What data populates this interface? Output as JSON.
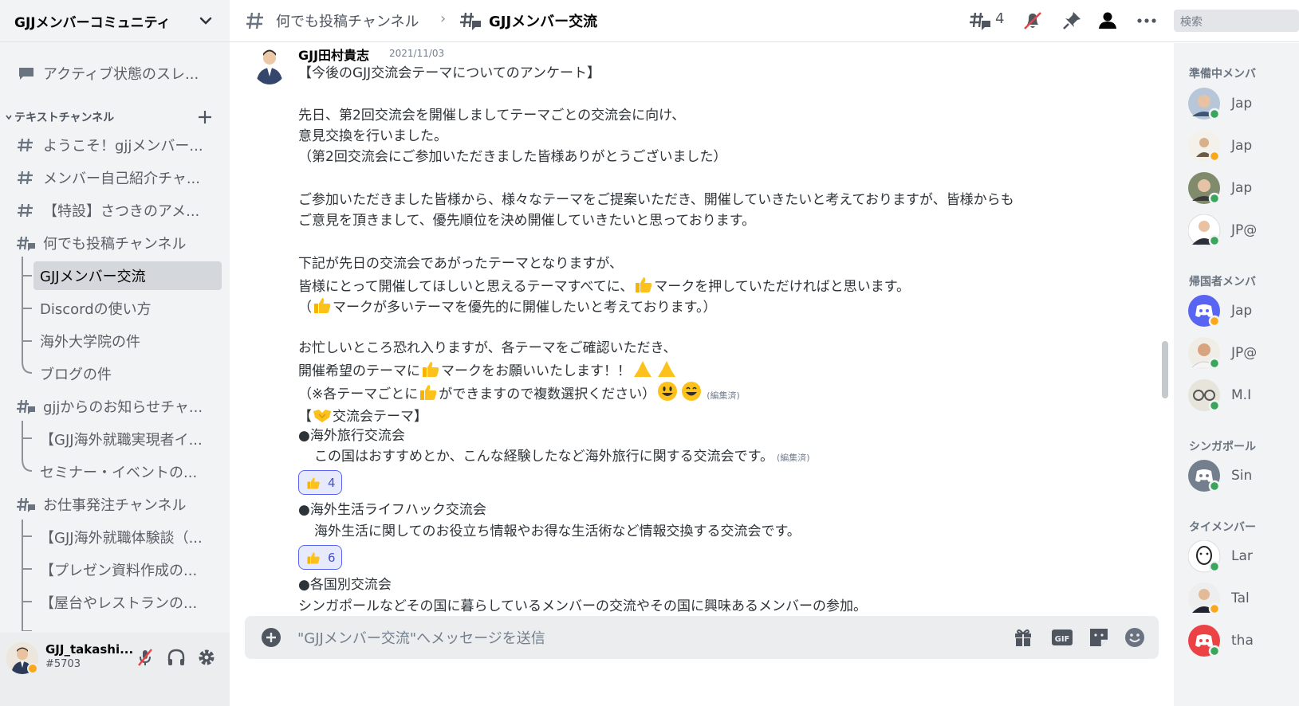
{
  "server": {
    "name": "GJJメンバーコミュニティ"
  },
  "sidebar": {
    "active_threads": "アクティブ状態のスレ...",
    "category": "テキストチャンネル",
    "items": [
      {
        "label": "ようこそ！gjjメンバー..."
      },
      {
        "label": "メンバー自己紹介チャ..."
      },
      {
        "label": "【特設】さつきのアメ..."
      },
      {
        "label": "何でも投稿チャンネル"
      },
      {
        "label": "GJJメンバー交流"
      },
      {
        "label": "Discordの使い方"
      },
      {
        "label": "海外大学院の件"
      },
      {
        "label": "ブログの件"
      },
      {
        "label": "gjjからのお知らせチャ..."
      },
      {
        "label": "【GJJ海外就職実現者イ..."
      },
      {
        "label": "セミナー・イベントの..."
      },
      {
        "label": "お仕事発注チャンネル"
      },
      {
        "label": "【GJJ海外就職体験談（..."
      },
      {
        "label": "【プレゼン資料作成の..."
      },
      {
        "label": "【屋台やレストランの..."
      }
    ]
  },
  "user": {
    "name": "GJJ_takashi...",
    "tag": "#5703"
  },
  "header": {
    "parent_channel": "何でも投稿チャンネル",
    "separator": "›",
    "thread": "GJJメンバー交流",
    "thread_count": "4",
    "search_placeholder": "検索"
  },
  "message": {
    "author": "GJJ田村貴志",
    "date": "2021/11/03",
    "lines": [
      "【今後のGJJ交流会テーマについてのアンケート】",
      "先日、第2回交流会を開催しましてテーマごとの交流会に向け、",
      "意見交換を行いました。",
      "（第2回交流会にご参加いただきました皆様ありがとうございました）",
      "ご参加いただきました皆様から、様々なテーマをご提案いただき、開催していきたいと考えておりますが、皆様からも",
      "ご意見を頂きまして、優先順位を決め開催していきたいと思っております。",
      "下記が先日の交流会であがったテーマとなりますが、",
      "皆様にとって開催してほしいと思えるテーマすべてに、",
      "マークを押していただければと思います。",
      "（",
      "マークが多いテーマを優先的に開催したいと考えております。）",
      "お忙しいところ恐れ入りますが、各テーマをご確認いただき、",
      "開催希望のテーマに",
      "マークをお願いいたします！！",
      "（※各テーマごとに",
      "ができますので複数選択ください）",
      "(編集済)",
      "【",
      "交流会テーマ】",
      "●海外旅行交流会",
      "この国はおすすめとか、こんな経験したなど海外旅行に関する交流会です。",
      "(編集済)",
      "●海外生活ライフハック交流会",
      "海外生活に関してのお役立ち情報やお得な生活術など情報交換する交流会です。",
      "●各国別交流会",
      "シンガポールなどその国に暮らしているメンバーの交流やその国に興味あるメンバーの参加。"
    ],
    "reactions": [
      {
        "count": "4"
      },
      {
        "count": "6"
      }
    ]
  },
  "composer": {
    "placeholder": "\"GJJメンバー交流\"へメッセージを送信"
  },
  "members": {
    "groups": [
      "準備中メンバ",
      "帰国者メンバ",
      "シンガポール",
      "タイメンバー"
    ],
    "names": [
      "Jap",
      "Jap",
      "Jap",
      "JP@",
      "Jap",
      "JP@",
      "M.I",
      "Sin",
      "Lar",
      "Tal",
      "tha"
    ]
  },
  "colors": {
    "accent": "#5865f2",
    "online": "#3ba55c",
    "idle": "#faa81a",
    "muted": "#ed4245"
  }
}
